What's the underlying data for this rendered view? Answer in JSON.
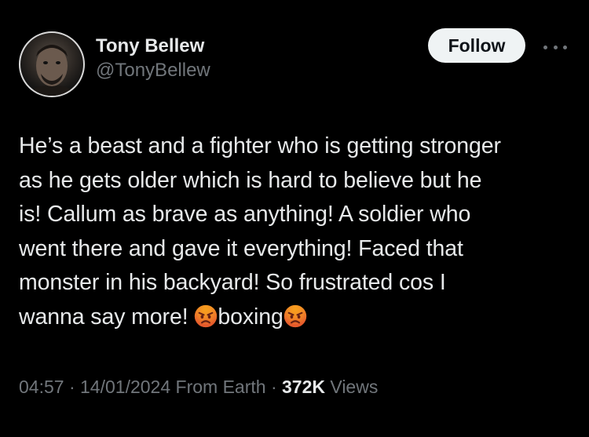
{
  "author": {
    "display_name": "Tony Bellew",
    "handle": "@TonyBellew"
  },
  "follow_button": {
    "label": "Follow"
  },
  "tweet": {
    "lines": {
      "l1": "He’s a beast and a fighter who is getting stronger",
      "l2": "as he gets older which is hard to believe but he",
      "l3": "is! Callum as brave as anything! A soldier who",
      "l4": "went there and gave it everything! Faced that",
      "l5": "monster in his backyard! So frustrated cos I",
      "l6a": "wanna say more! ",
      "l6b": "boxing"
    },
    "emojis": [
      "angry-face-icon",
      "angry-face-icon"
    ]
  },
  "meta": {
    "time": "04:57",
    "sep1": " · ",
    "date": "14/01/2024",
    "source": " From Earth",
    "sep2": " · ",
    "views_count": "372K",
    "views_label": " Views"
  },
  "colors": {
    "background": "#000000",
    "primary_text": "#e7e9ea",
    "secondary_text": "#71767b",
    "follow_bg": "#eff3f4",
    "follow_text": "#0f1419"
  },
  "icons": {
    "more": "more-horizontal-icon",
    "avatar": "avatar"
  }
}
